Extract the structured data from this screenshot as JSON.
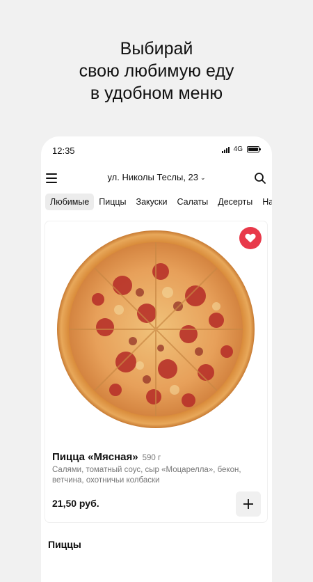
{
  "headline": {
    "line1": "Выбирай",
    "line2": "свою любимую еду",
    "line3": "в удобном меню"
  },
  "status_bar": {
    "time": "12:35",
    "network": "4G"
  },
  "header": {
    "address": "ул. Николы Теслы, 23",
    "icons": [
      "menu-icon",
      "chevron-down-icon",
      "search-icon"
    ]
  },
  "tabs": [
    {
      "label": "Любимые",
      "active": true
    },
    {
      "label": "Пиццы",
      "active": false
    },
    {
      "label": "Закуски",
      "active": false
    },
    {
      "label": "Салаты",
      "active": false
    },
    {
      "label": "Десерты",
      "active": false
    },
    {
      "label": "На",
      "active": false
    }
  ],
  "product": {
    "name": "Пицца «Мясная»",
    "weight": "590 г",
    "description": "Салями, томатный соус, сыр «Моцарелла», бекон, ветчина, охотничьи колбаски",
    "price": "21,50 руб.",
    "favorite": true
  },
  "section_title": "Пиццы",
  "colors": {
    "background": "#f1f1f1",
    "accent": "#e8394a"
  }
}
